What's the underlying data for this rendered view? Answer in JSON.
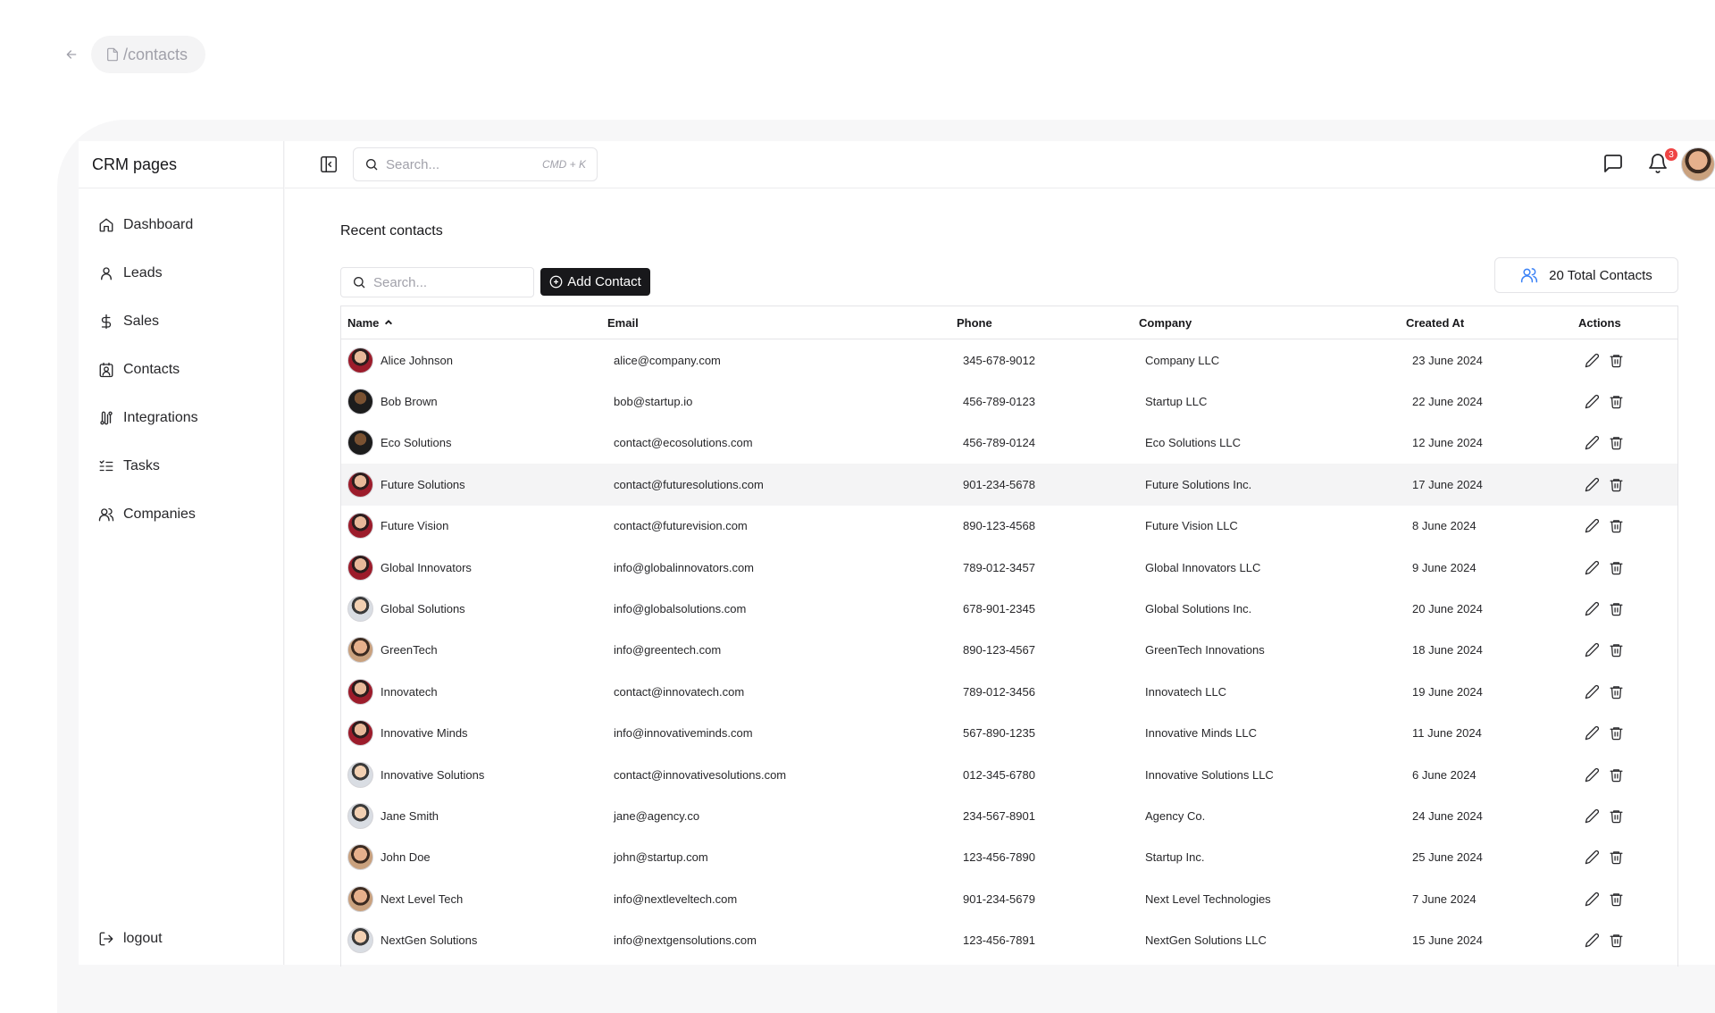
{
  "breadcrumb": {
    "path": "/contacts"
  },
  "app": {
    "title": "CRM pages"
  },
  "sidebar": {
    "items": [
      {
        "label": "Dashboard",
        "icon": "home-icon"
      },
      {
        "label": "Leads",
        "icon": "user-icon"
      },
      {
        "label": "Sales",
        "icon": "dollar-icon"
      },
      {
        "label": "Contacts",
        "icon": "contact-icon"
      },
      {
        "label": "Integrations",
        "icon": "integrations-icon"
      },
      {
        "label": "Tasks",
        "icon": "tasks-icon"
      },
      {
        "label": "Companies",
        "icon": "users-icon"
      }
    ],
    "logout": "logout"
  },
  "topbar": {
    "search_placeholder": "Search...",
    "shortcut": "CMD + K",
    "notification_count": "3"
  },
  "contacts": {
    "title": "Recent contacts",
    "search_placeholder": "Search...",
    "add_label": "Add Contact",
    "total_label": "20 Total Contacts",
    "columns": {
      "name": "Name",
      "email": "Email",
      "phone": "Phone",
      "company": "Company",
      "created": "Created At",
      "actions": "Actions"
    },
    "rows": [
      {
        "name": "Alice Johnson",
        "email": "alice@company.com",
        "phone": "345-678-9012",
        "company": "Company LLC",
        "created": "23 June 2024"
      },
      {
        "name": "Bob Brown",
        "email": "bob@startup.io",
        "phone": "456-789-0123",
        "company": "Startup LLC",
        "created": "22 June 2024"
      },
      {
        "name": "Eco Solutions",
        "email": "contact@ecosolutions.com",
        "phone": "456-789-0124",
        "company": "Eco Solutions LLC",
        "created": "12 June 2024"
      },
      {
        "name": "Future Solutions",
        "email": "contact@futuresolutions.com",
        "phone": "901-234-5678",
        "company": "Future Solutions Inc.",
        "created": "17 June 2024"
      },
      {
        "name": "Future Vision",
        "email": "contact@futurevision.com",
        "phone": "890-123-4568",
        "company": "Future Vision LLC",
        "created": "8 June 2024"
      },
      {
        "name": "Global Innovators",
        "email": "info@globalinnovators.com",
        "phone": "789-012-3457",
        "company": "Global Innovators LLC",
        "created": "9 June 2024"
      },
      {
        "name": "Global Solutions",
        "email": "info@globalsolutions.com",
        "phone": "678-901-2345",
        "company": "Global Solutions Inc.",
        "created": "20 June 2024"
      },
      {
        "name": "GreenTech",
        "email": "info@greentech.com",
        "phone": "890-123-4567",
        "company": "GreenTech Innovations",
        "created": "18 June 2024"
      },
      {
        "name": "Innovatech",
        "email": "contact@innovatech.com",
        "phone": "789-012-3456",
        "company": "Innovatech LLC",
        "created": "19 June 2024"
      },
      {
        "name": "Innovative Minds",
        "email": "info@innovativeminds.com",
        "phone": "567-890-1235",
        "company": "Innovative Minds LLC",
        "created": "11 June 2024"
      },
      {
        "name": "Innovative Solutions",
        "email": "contact@innovativesolutions.com",
        "phone": "012-345-6780",
        "company": "Innovative Solutions LLC",
        "created": "6 June 2024"
      },
      {
        "name": "Jane Smith",
        "email": "jane@agency.co",
        "phone": "234-567-8901",
        "company": "Agency Co.",
        "created": "24 June 2024"
      },
      {
        "name": "John Doe",
        "email": "john@startup.com",
        "phone": "123-456-7890",
        "company": "Startup Inc.",
        "created": "25 June 2024"
      },
      {
        "name": "Next Level Tech",
        "email": "info@nextleveltech.com",
        "phone": "901-234-5679",
        "company": "Next Level Technologies",
        "created": "7 June 2024"
      },
      {
        "name": "NextGen Solutions",
        "email": "info@nextgensolutions.com",
        "phone": "123-456-7891",
        "company": "NextGen Solutions LLC",
        "created": "15 June 2024"
      }
    ]
  }
}
